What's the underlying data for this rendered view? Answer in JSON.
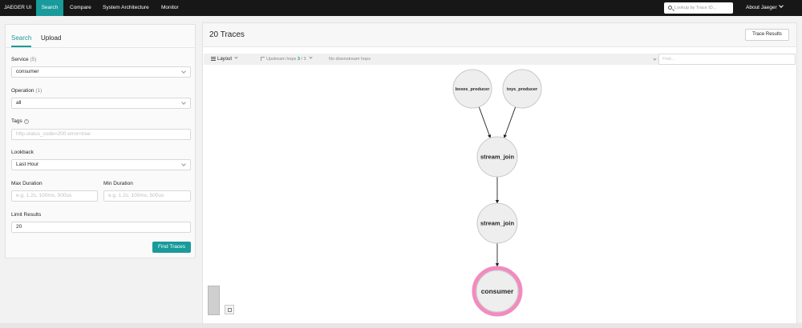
{
  "nav": {
    "brand": "JAEGER UI",
    "items": [
      "Search",
      "Compare",
      "System Architecture",
      "Monitor"
    ],
    "lookup_placeholder": "Lookup by Trace ID...",
    "about": "About Jaeger"
  },
  "search": {
    "tabs": [
      "Search",
      "Upload"
    ],
    "service": {
      "label": "Service",
      "count": "(5)",
      "value": "consumer"
    },
    "operation": {
      "label": "Operation",
      "count": "(1)",
      "value": "all"
    },
    "tags": {
      "label": "Tags",
      "placeholder": "http.status_code=200 error=true"
    },
    "lookback": {
      "label": "Lookback",
      "value": "Last Hour"
    },
    "max_duration": {
      "label": "Max Duration",
      "placeholder": "e.g. 1.2s, 100ms, 500us"
    },
    "min_duration": {
      "label": "Min Duration",
      "placeholder": "e.g. 1.2s, 100ms, 500us"
    },
    "limit": {
      "label": "Limit Results",
      "value": "20"
    },
    "find_button": "Find Traces"
  },
  "results": {
    "title": "20 Traces",
    "trace_results_button": "Trace Results",
    "toolbar": {
      "layout": "Layout",
      "upstream_label": "Upstream hops",
      "upstream_current": "3",
      "upstream_sep": " / ",
      "upstream_total": "3",
      "downstream": "No downstream hops",
      "find_placeholder": "Find..."
    }
  },
  "graph": {
    "nodes": [
      {
        "id": "boxes_producer",
        "label": "boxes_producer"
      },
      {
        "id": "toys_producer",
        "label": "toys_producer"
      },
      {
        "id": "stream_join_1",
        "label": "stream_join"
      },
      {
        "id": "stream_join_2",
        "label": "stream_join"
      },
      {
        "id": "consumer",
        "label": "consumer",
        "focal": true
      }
    ],
    "edges": [
      {
        "from": "boxes_producer",
        "to": "stream_join_1"
      },
      {
        "from": "toys_producer",
        "to": "stream_join_1"
      },
      {
        "from": "stream_join_1",
        "to": "stream_join_2"
      },
      {
        "from": "stream_join_2",
        "to": "consumer"
      }
    ],
    "colors": {
      "node_fill": "#eeeeee",
      "node_stroke": "#c8c8c8",
      "focal_ring": "#f28bbf",
      "edge": "#222222"
    }
  }
}
